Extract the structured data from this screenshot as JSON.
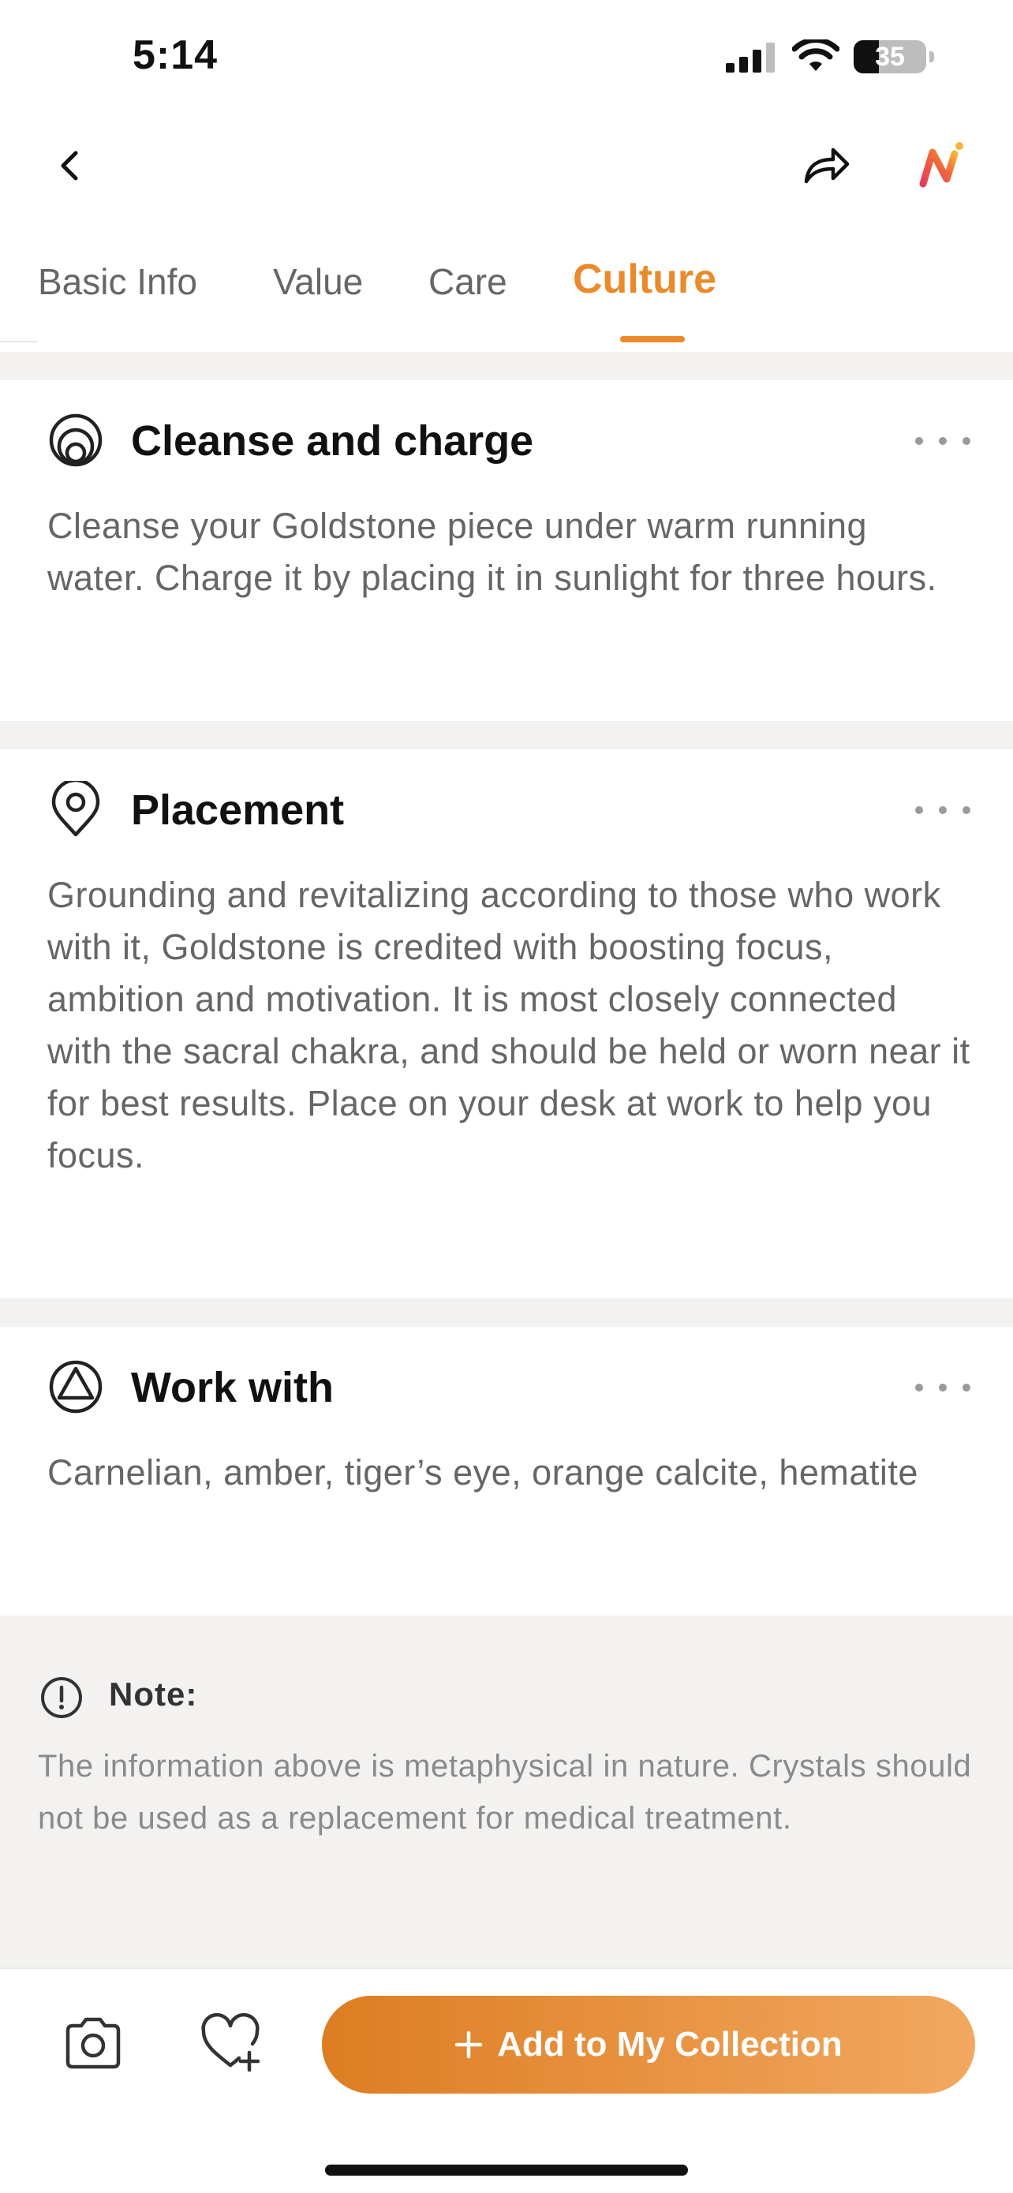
{
  "status_bar": {
    "time": "5:14",
    "battery": "35",
    "battery_level_percent": 35
  },
  "nav": {
    "back_icon": "chevron-left-icon",
    "share_icon": "share-icon",
    "logo_icon": "app-logo-icon"
  },
  "tabs": [
    {
      "label": "Basic Info",
      "active": false
    },
    {
      "label": "Value",
      "active": false
    },
    {
      "label": "Care",
      "active": false
    },
    {
      "label": "Culture",
      "active": true
    }
  ],
  "sections": [
    {
      "icon": "cleanse-icon",
      "title": "Cleanse and charge",
      "body": "Cleanse your Goldstone piece under warm running water. Charge it by placing it in sunlight for three hours."
    },
    {
      "icon": "location-pin-icon",
      "title": "Placement",
      "body": "Grounding and revitalizing according to those who work with it, Goldstone is credited with boosting focus, ambition and motivation. It is most closely connected with the sacral chakra, and should be held or worn near it for best results. Place on your desk at work to help you focus."
    },
    {
      "icon": "triangle-circle-icon",
      "title": "Work with",
      "body": "Carnelian, amber, tiger’s eye, orange calcite, hematite"
    }
  ],
  "note": {
    "title": "Note:",
    "text": "The information above is metaphysical in nature. Crystals should not be used as a replacement for medical treatment."
  },
  "bottom_bar": {
    "add_label": "Add to My Collection",
    "add_icon": "plus-icon",
    "camera_icon": "camera-icon",
    "favorite_icon": "heart-plus-icon"
  },
  "colors": {
    "accent": "#ea8a2a",
    "text_muted": "#666666",
    "separator": "#f3f2f0"
  }
}
